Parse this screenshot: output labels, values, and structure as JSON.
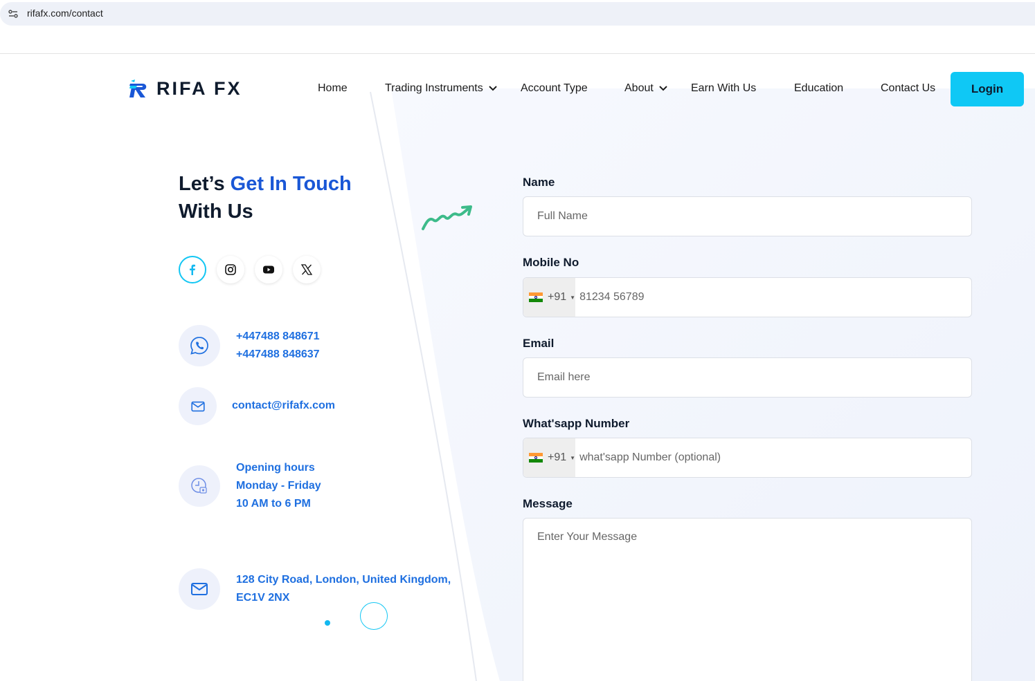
{
  "browser": {
    "url": "rifafx.com/contact"
  },
  "header": {
    "logo_text": "RIFA FX",
    "nav": [
      {
        "label": "Home",
        "has_dropdown": false
      },
      {
        "label": "Trading Instruments",
        "has_dropdown": true
      },
      {
        "label": "Account Type",
        "has_dropdown": false
      },
      {
        "label": "About",
        "has_dropdown": true
      },
      {
        "label": "Earn With Us",
        "has_dropdown": false
      },
      {
        "label": "Education",
        "has_dropdown": false
      },
      {
        "label": "Contact Us",
        "has_dropdown": false
      }
    ],
    "login_label": "Login"
  },
  "contact": {
    "heading_part1": "Let’s ",
    "heading_accent": "Get In Touch",
    "heading_part2": "With Us",
    "social": [
      "facebook-icon",
      "instagram-icon",
      "youtube-icon",
      "x-icon"
    ],
    "phones": [
      "+447488 848671",
      "+447488 848637"
    ],
    "email": "contact@rifafx.com",
    "hours": [
      "Opening hours",
      "Monday - Friday",
      "10 AM to 6 PM"
    ],
    "address": [
      "128 City Road, London, United Kingdom,",
      "EC1V 2NX"
    ]
  },
  "form": {
    "name_label": "Name",
    "name_placeholder": "Full Name",
    "mobile_label": "Mobile No",
    "mobile_country_code": "+91",
    "mobile_placeholder": "81234 56789",
    "email_label": "Email",
    "email_placeholder": "Email here",
    "whatsapp_label": "What'sapp Number",
    "whatsapp_country_code": "+91",
    "whatsapp_placeholder": "what'sapp Number (optional)",
    "message_label": "Message",
    "message_placeholder": "Enter Your Message"
  },
  "colors": {
    "accent_cyan": "#0fc8f5",
    "heading_blue": "#1a57d6",
    "link_blue": "#1e6fe0",
    "dark_text": "#0f1b2d"
  }
}
